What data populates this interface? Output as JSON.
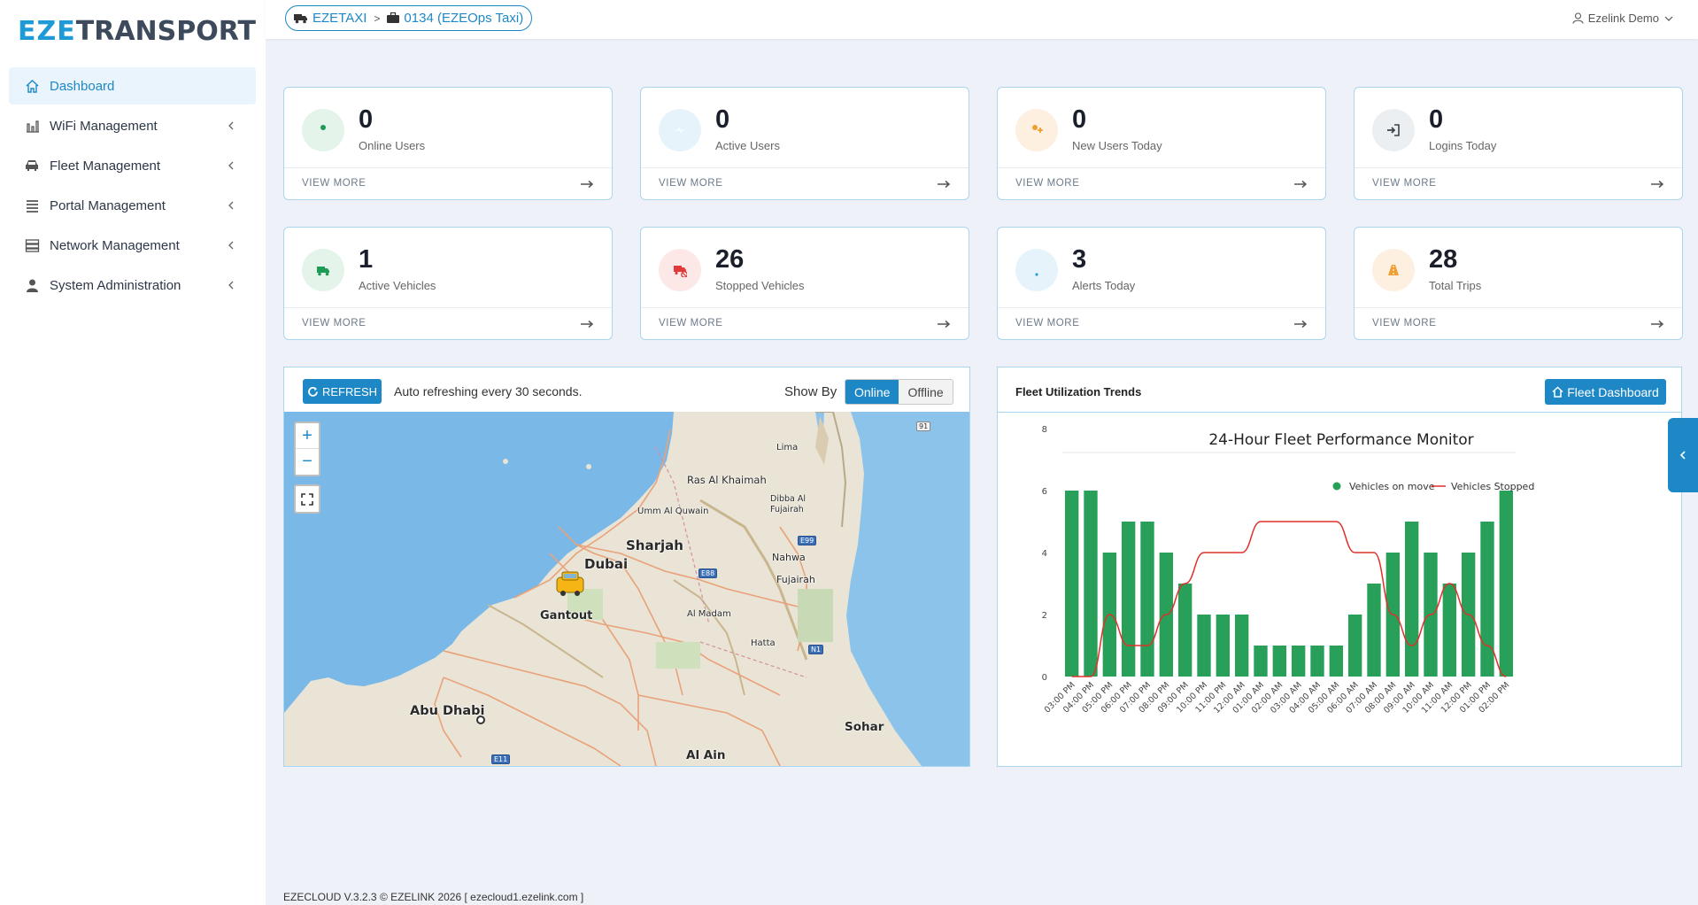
{
  "brand": {
    "part1": "EZE",
    "part2": "TRANSPORT",
    "color": "#1e9bd7"
  },
  "sidebar": {
    "items": [
      {
        "label": "Dashboard",
        "icon": "home-icon",
        "active": true
      },
      {
        "label": "WiFi Management",
        "icon": "bar-chart-icon"
      },
      {
        "label": "Fleet Management",
        "icon": "car-icon"
      },
      {
        "label": "Portal Management",
        "icon": "list-icon"
      },
      {
        "label": "Network Management",
        "icon": "server-icon"
      },
      {
        "label": "System Administration",
        "icon": "user-icon"
      }
    ]
  },
  "breadcrumb": {
    "first": "EZETAXI",
    "second": "0134 (EZEOps Taxi)"
  },
  "user": {
    "name": "Ezelink Demo"
  },
  "stats": [
    {
      "value": "0",
      "label": "Online Users",
      "icon": "user-icon",
      "tint": "#e4f4ea",
      "color": "#1e9b55"
    },
    {
      "value": "0",
      "label": "Active Users",
      "icon": "heartbeat-icon",
      "tint": "#e6f3fb",
      "color": "#2b9fd8"
    },
    {
      "value": "0",
      "label": "New Users Today",
      "icon": "user-plus-icon",
      "tint": "#fdf0e0",
      "color": "#f0a030"
    },
    {
      "value": "0",
      "label": "Logins Today",
      "icon": "sign-in-icon",
      "tint": "#eceff2",
      "color": "#3a4350"
    },
    {
      "value": "1",
      "label": "Active Vehicles",
      "icon": "truck-icon",
      "tint": "#e4f4ea",
      "color": "#1e9b55"
    },
    {
      "value": "26",
      "label": "Stopped Vehicles",
      "icon": "truck-stopped-icon",
      "tint": "#fde8e8",
      "color": "#e23a3a"
    },
    {
      "value": "3",
      "label": "Alerts Today",
      "icon": "bell-icon",
      "tint": "#e6f3fb",
      "color": "#2b9fd8"
    },
    {
      "value": "28",
      "label": "Total Trips",
      "icon": "road-icon",
      "tint": "#fdf0e0",
      "color": "#f0a030"
    }
  ],
  "view_more_label": "VIEW MORE",
  "map_panel": {
    "refresh_label": "REFRESH",
    "auto_text": "Auto refreshing every 30 seconds.",
    "show_by_label": "Show By",
    "online_label": "Online",
    "offline_label": "Offline",
    "place_labels": [
      "Lima",
      "Ras Al Khaimah",
      "Dibba Al Fujairah",
      "Umm Al Quwain",
      "Sharjah",
      "Dubai",
      "Nahwa",
      "Fujairah",
      "Gantout",
      "Al Madam",
      "Hatta",
      "Abu Dhabi",
      "Sohar",
      "Al Ain"
    ],
    "road_shields": [
      "E99",
      "E88",
      "N1",
      "E11",
      "91"
    ]
  },
  "chart_panel": {
    "title": "Fleet Utilization Trends",
    "button_label": "Fleet Dashboard"
  },
  "chart_data": {
    "type": "bar",
    "title": "24-Hour Fleet Performance Monitor",
    "categories": [
      "03:00 PM",
      "04:00 PM",
      "05:00 PM",
      "06:00 PM",
      "07:00 PM",
      "08:00 PM",
      "09:00 PM",
      "10:00 PM",
      "11:00 PM",
      "12:00 AM",
      "01:00 AM",
      "02:00 AM",
      "03:00 AM",
      "04:00 AM",
      "05:00 AM",
      "06:00 AM",
      "07:00 AM",
      "08:00 AM",
      "09:00 AM",
      "10:00 AM",
      "11:00 AM",
      "12:00 PM",
      "01:00 PM",
      "02:00 PM"
    ],
    "series": [
      {
        "name": "Vehicles on move",
        "type": "bar",
        "color": "#28a05a",
        "values": [
          6,
          6,
          4,
          5,
          5,
          4,
          3,
          2,
          2,
          2,
          1,
          1,
          1,
          1,
          1,
          2,
          3,
          4,
          5,
          4,
          3,
          4,
          5,
          6
        ]
      },
      {
        "name": "Vehicles Stopped",
        "type": "line",
        "color": "#e0302a",
        "values": [
          0,
          0,
          2,
          1,
          1,
          2,
          3,
          4,
          4,
          4,
          5,
          5,
          5,
          5,
          5,
          4,
          4,
          2,
          1,
          2,
          3,
          2,
          1,
          0
        ]
      }
    ],
    "yticks": [
      0,
      2,
      4,
      6,
      8
    ],
    "ylim": [
      0,
      8
    ],
    "legend_position": "top-right",
    "grid": false
  },
  "footer": {
    "text": "EZECLOUD V.3.2.3 © EZELINK 2026 [ ezecloud1.ezelink.com ]"
  }
}
